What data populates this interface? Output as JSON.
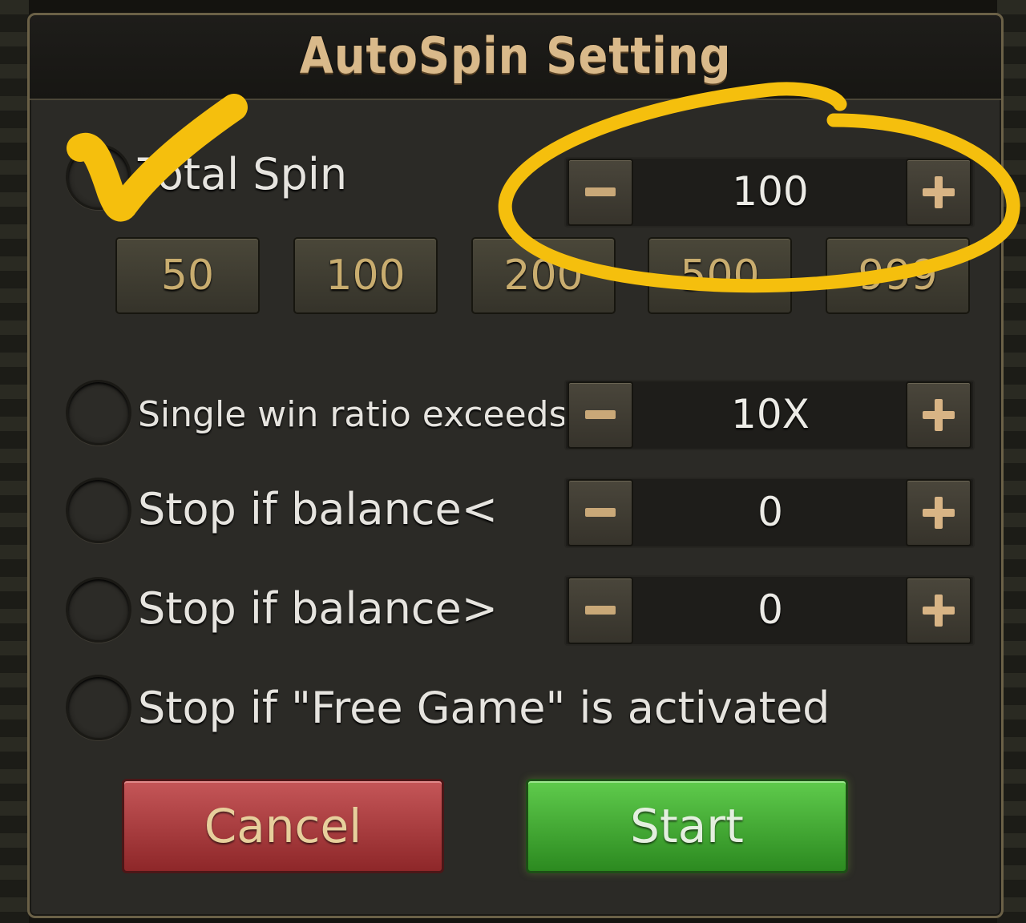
{
  "dialog": {
    "title": "AutoSpin Setting"
  },
  "total_spin": {
    "label": "Total Spin",
    "value": "100",
    "presets": [
      "50",
      "100",
      "200",
      "500",
      "999"
    ]
  },
  "options": [
    {
      "label": "Single win ratio exceeds",
      "value": "10X"
    },
    {
      "label": "Stop if balance<",
      "value": "0"
    },
    {
      "label": "Stop if balance>",
      "value": "0"
    },
    {
      "label": "Stop if \"Free Game\" is activated"
    }
  ],
  "buttons": {
    "cancel": "Cancel",
    "start": "Start"
  },
  "colors": {
    "annotation": "#f5bf0d",
    "title_text": "#d9b98a",
    "cancel_button": "#b23a3c",
    "start_button": "#45b034"
  },
  "icons": {
    "stepper_minus": "minus-icon",
    "stepper_plus": "plus-icon",
    "annotation_check": "checkmark-icon",
    "annotation_circle": "highlight-circle-icon"
  }
}
